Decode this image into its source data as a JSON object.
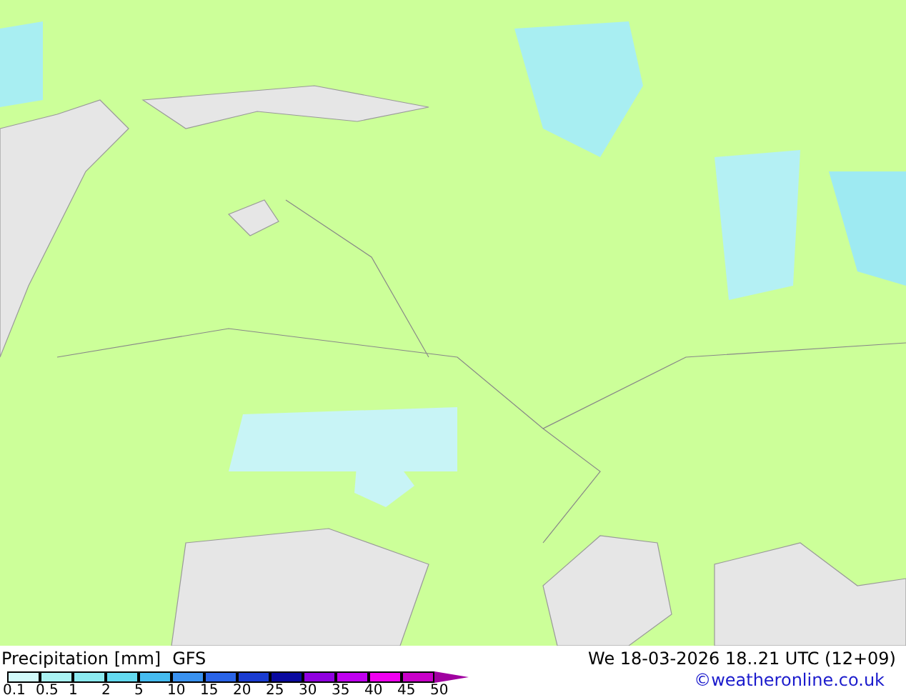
{
  "legend": {
    "title": "Precipitation [mm]",
    "model": "GFS",
    "bins": [
      {
        "label": "0.1",
        "color": "#d2fafa"
      },
      {
        "label": "0.5",
        "color": "#aaf2f2"
      },
      {
        "label": "1",
        "color": "#8ceaf0"
      },
      {
        "label": "2",
        "color": "#64daf0"
      },
      {
        "label": "5",
        "color": "#46bcf0"
      },
      {
        "label": "10",
        "color": "#3a92f0"
      },
      {
        "label": "15",
        "color": "#2a64e8"
      },
      {
        "label": "20",
        "color": "#1a3cd2"
      },
      {
        "label": "25",
        "color": "#0a0aa0"
      },
      {
        "label": "30",
        "color": "#9000e0"
      },
      {
        "label": "35",
        "color": "#c000f0"
      },
      {
        "label": "40",
        "color": "#f000f0"
      },
      {
        "label": "45",
        "color": "#c800c8"
      }
    ],
    "last_label": "50"
  },
  "valid_time": "We 18-03-2026 18..21 UTC (12+09)",
  "credit": "©weatheronline.co.uk"
}
